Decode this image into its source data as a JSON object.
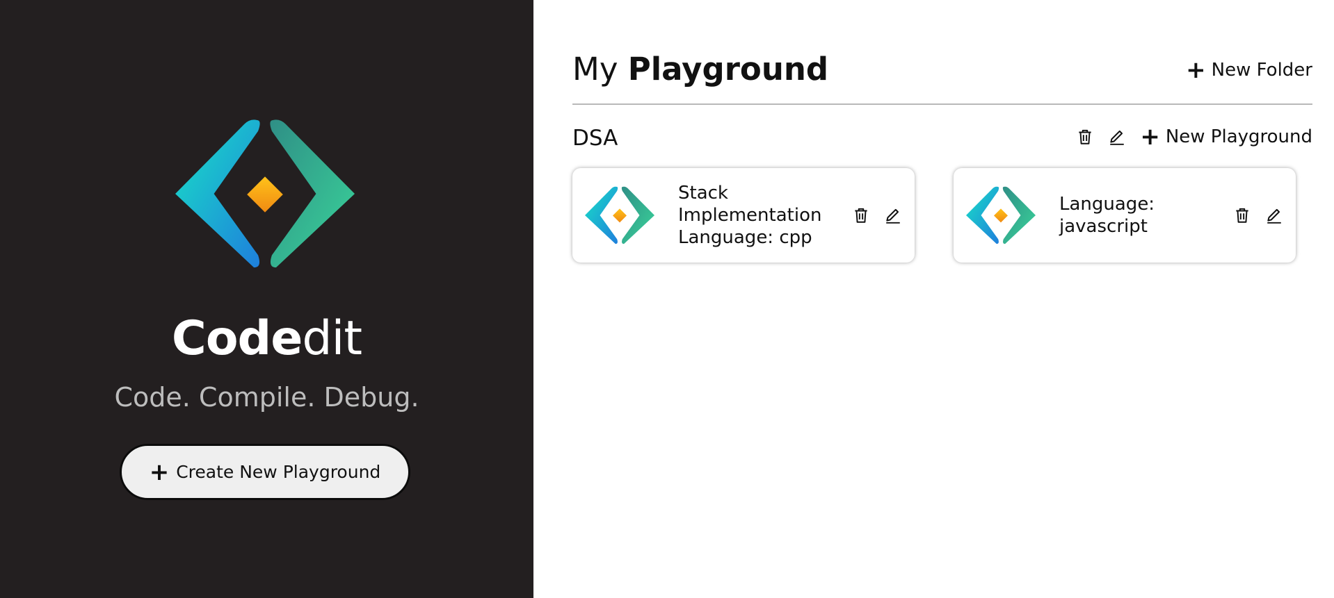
{
  "brand": {
    "title_bold": "Code",
    "title_light": "dit",
    "tagline": "Code. Compile. Debug.",
    "create_button": "Create New Playground",
    "logo_icon": "codedit-logo-icon"
  },
  "colors": {
    "left_bg": "#231f20",
    "logo_teal": "#19d6c8",
    "logo_blue": "#1e8fe0",
    "logo_green": "#3cc78e",
    "logo_orange": "#f8a21a"
  },
  "header": {
    "title_light": "My",
    "title_bold": "Playground",
    "new_folder": "New Folder"
  },
  "folders": [
    {
      "name": "DSA",
      "new_playground": "New Playground",
      "cards": [
        {
          "title": "Stack Implementation",
          "language": "Language: cpp"
        },
        {
          "title": "",
          "language": "Language: javascript"
        }
      ]
    }
  ]
}
